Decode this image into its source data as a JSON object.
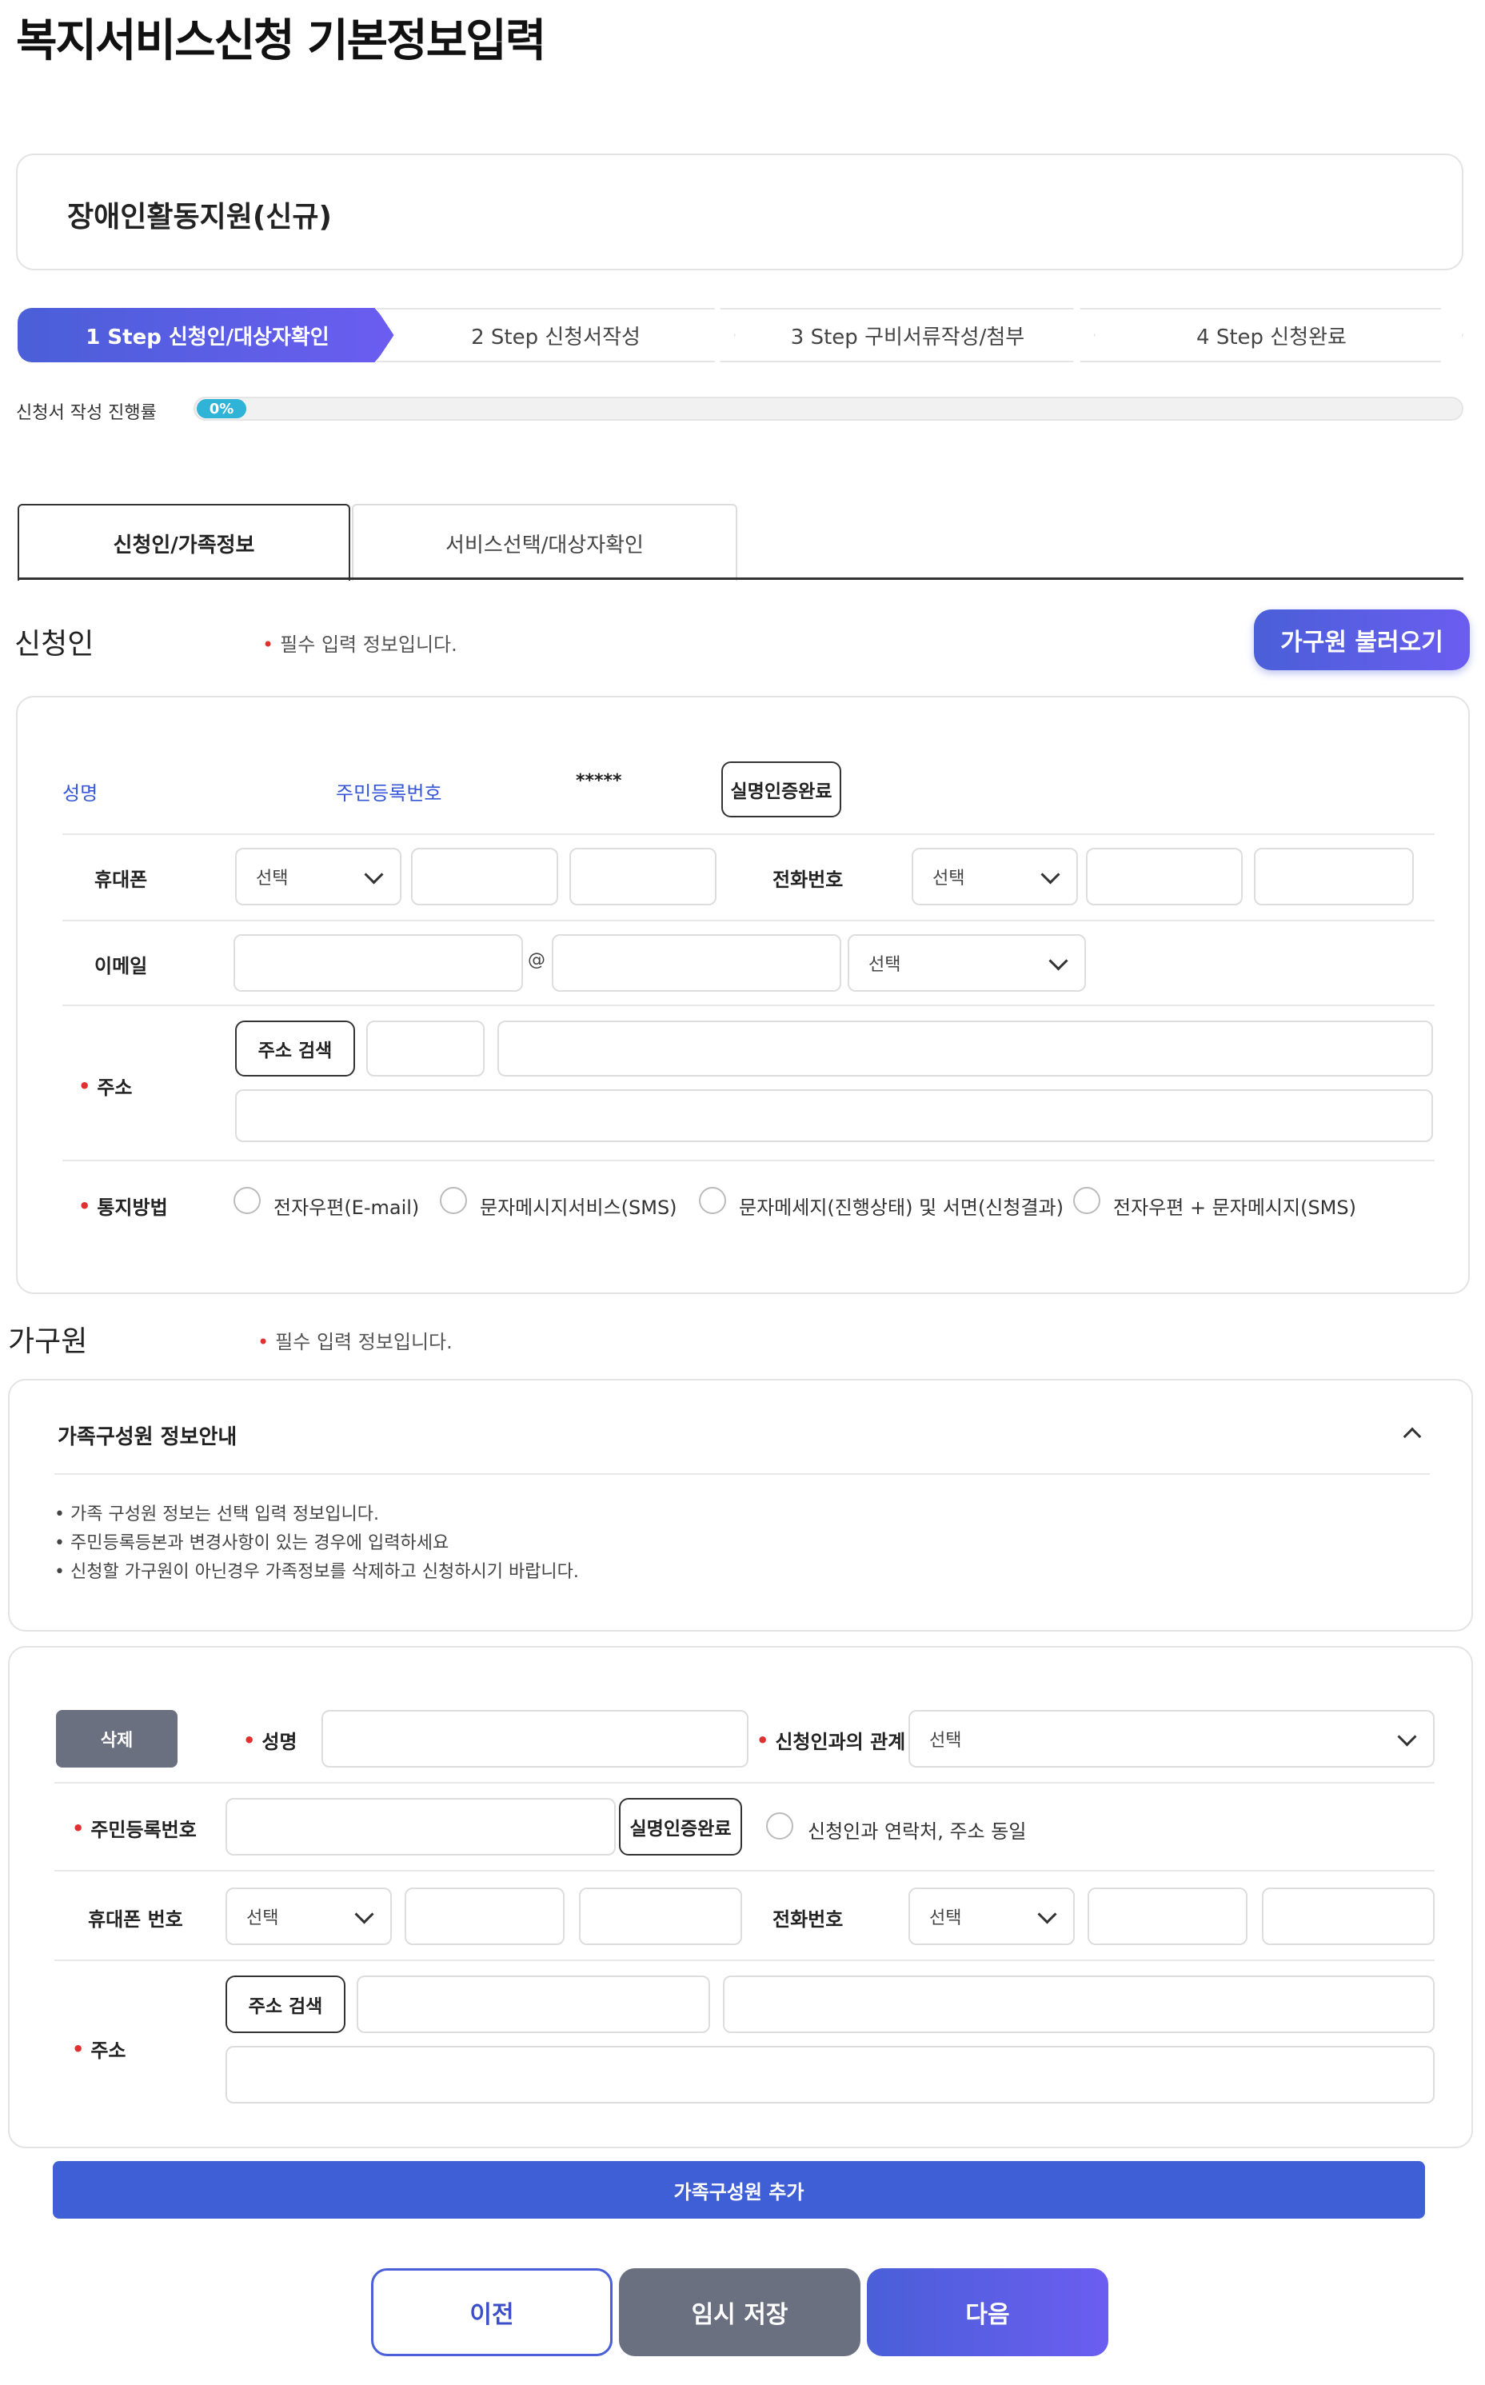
{
  "page_title": "복지서비스신청 기본정보입력",
  "service_name": "장애인활동지원(신규)",
  "steps": [
    {
      "label": "1 Step 신청인/대상자확인",
      "active": true
    },
    {
      "label": "2 Step 신청서작성",
      "active": false
    },
    {
      "label": "3 Step 구비서류작성/첨부",
      "active": false
    },
    {
      "label": "4 Step 신청완료",
      "active": false
    }
  ],
  "progress": {
    "label": "신청서 작성 진행률",
    "value_text": "0%",
    "value": 0
  },
  "tabs": [
    {
      "label": "신청인/가족정보",
      "active": true
    },
    {
      "label": "서비스선택/대상자확인",
      "active": false
    }
  ],
  "applicant": {
    "heading": "신청인",
    "required_note": "필수 입력 정보입니다.",
    "load_household_button": "가구원 불러오기",
    "name_label": "성명",
    "rrn_label": "주민등록번호",
    "rrn_value": "*****",
    "verified_button": "실명인증완료",
    "mobile_label": "휴대폰",
    "mobile_select": "선택",
    "phone_label": "전화번호",
    "phone_select": "선택",
    "email_label": "이메일",
    "email_at": "@",
    "email_select": "선택",
    "address_label": "주소",
    "address_search_button": "주소 검색",
    "notify_label": "통지방법",
    "notify_options": [
      "전자우편(E-mail)",
      "문자메시지서비스(SMS)",
      "문자메세지(진행상태) 및 서면(신청결과)",
      "전자우편 + 문자메시지(SMS)"
    ]
  },
  "household": {
    "heading": "가구원",
    "required_note": "필수 입력 정보입니다.",
    "info_title": "가족구성원 정보안내",
    "info_lines": [
      "가족 구성원 정보는 선택 입력 정보입니다.",
      "주민등록등본과 변경사항이 있는 경우에 입력하세요",
      "신청할 가구원이 아닌경우 가족정보를 삭제하고 신청하시기 바랍니다."
    ],
    "delete_button": "삭제",
    "name_label": "성명",
    "relation_label": "신청인과의 관계",
    "relation_select": "선택",
    "rrn_label": "주민등록번호",
    "verified_button": "실명인증완료",
    "same_contact_label": "신청인과 연락처, 주소 동일",
    "mobile_label": "휴대폰 번호",
    "mobile_select": "선택",
    "phone_label": "전화번호",
    "phone_select": "선택",
    "address_label": "주소",
    "address_search_button": "주소 검색",
    "add_member_button": "가족구성원 추가"
  },
  "footer": {
    "prev_button": "이전",
    "temp_save_button": "임시 저장",
    "next_button": "다음"
  }
}
